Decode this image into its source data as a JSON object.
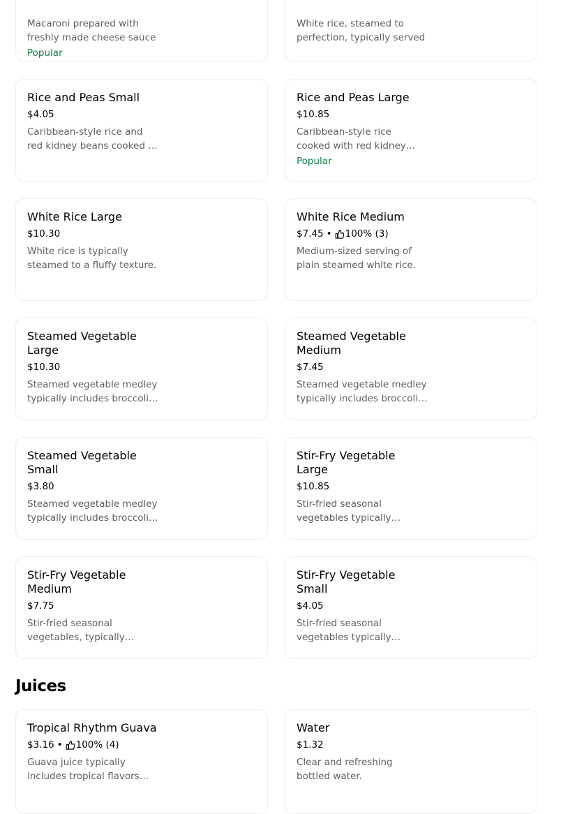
{
  "top_cards": [
    {
      "description": "Macaroni prepared with freshly made cheese sauce",
      "badge": "Popular"
    },
    {
      "description": "White rice, steamed to perfection, typically served",
      "badge": ""
    }
  ],
  "rice_cards": [
    {
      "name": "Rice and Peas Small",
      "price": "$4.05",
      "rating": "",
      "description": "Caribbean-style rice and red kidney beans cooked in coconut milk",
      "badge": ""
    },
    {
      "name": "Rice and Peas Large",
      "price": "$10.85",
      "rating": "",
      "description": "Caribbean-style rice cooked with red kidney beans, coconut milk",
      "badge": "Popular"
    },
    {
      "name": "White Rice Large",
      "price": "$10.30",
      "rating": "",
      "description": "White rice is typically steamed to a fluffy texture.",
      "badge": ""
    },
    {
      "name": "White Rice Medium",
      "price": "$7.45",
      "rating": "100% (3)",
      "description": "Medium-sized serving of plain steamed white rice.",
      "badge": ""
    },
    {
      "name": "Steamed Vegetable Large",
      "price": "$10.30",
      "rating": "",
      "description": "Steamed vegetable medley typically includes broccoli, carrots",
      "badge": ""
    },
    {
      "name": "Steamed Vegetable Medium",
      "price": "$7.45",
      "rating": "",
      "description": "Steamed vegetable medley typically includes broccoli, carrots",
      "badge": ""
    },
    {
      "name": "Steamed Vegetable Small",
      "price": "$3.80",
      "rating": "",
      "description": "Steamed vegetable medley typically includes broccoli, carrots",
      "badge": ""
    },
    {
      "name": "Stir-Fry Vegetable Large",
      "price": "$10.85",
      "rating": "",
      "description": "Stir-fried seasonal vegetables typically including peppers",
      "badge": ""
    },
    {
      "name": "Stir-Fry Vegetable Medium",
      "price": "$7.75",
      "rating": "",
      "description": "Stir-fried seasonal vegetables, typically including peppers",
      "badge": ""
    },
    {
      "name": "Stir-Fry Vegetable Small",
      "price": "$4.05",
      "rating": "",
      "description": "Stir-fried seasonal vegetables typically including peppers",
      "badge": ""
    }
  ],
  "juices_section": {
    "title": "Juices",
    "cards": [
      {
        "name": "Tropical Rhythm Guava",
        "price": "$3.16",
        "rating": "100% (4)",
        "description": "Guava juice typically includes tropical flavors and",
        "badge": ""
      },
      {
        "name": "Water",
        "price": "$1.32",
        "rating": "",
        "description": "Clear and refreshing bottled water.",
        "badge": ""
      }
    ]
  },
  "colors": {
    "popular": "#0e8345",
    "description": "#5e5e5e",
    "border": "#eeeeee"
  },
  "icons": {
    "rating": "thumbs-up-icon"
  }
}
